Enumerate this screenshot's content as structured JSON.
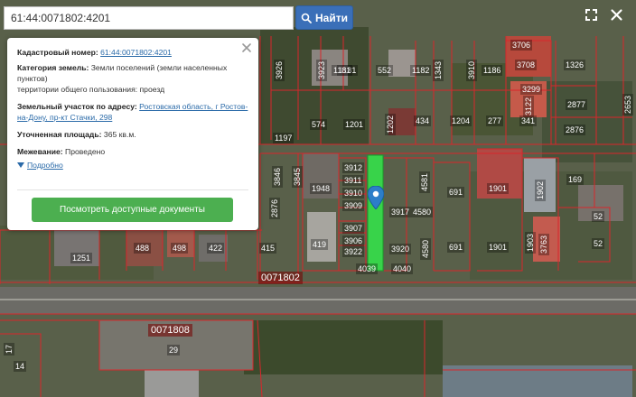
{
  "search": {
    "value": "61:44:0071802:4201",
    "button_label": "Найти"
  },
  "info_panel": {
    "cadastral_label": "Кадастровый номер:",
    "cadastral_value": "61:44:0071802:4201",
    "category_label": "Категория земель:",
    "category_value": "Земли поселений (земли населенных пунктов)",
    "usage_value": "территории общего пользования: проезд",
    "address_label": "Земельный участок по адресу:",
    "address_value": "Ростовская область, г Ростов-на-Дону, пр-кт Стачки, 298",
    "area_label": "Уточненная площадь:",
    "area_value": "365 кв.м.",
    "survey_label": "Межевание:",
    "survey_value": "Проведено",
    "details_label": "Подробно",
    "docs_button_label": "Посмотреть доступные документы"
  },
  "map": {
    "quarter_labels": [
      "0071802",
      "0071808"
    ],
    "plot_labels": [
      "3706",
      "3708",
      "1326",
      "3926",
      "3923",
      "1181",
      "552",
      "1182",
      "1181",
      "3910",
      "1186",
      "1343",
      "2877",
      "2876",
      "2653",
      "574",
      "1201",
      "1202",
      "434",
      "1204",
      "277",
      "341",
      "3122",
      "1197",
      "3299",
      "3912",
      "3911",
      "3910",
      "3909",
      "3907",
      "3906",
      "3922",
      "3917",
      "4580",
      "3920",
      "4580",
      "4581",
      "1948",
      "3846",
      "3845",
      "2876",
      "691",
      "1901",
      "1902",
      "169",
      "52",
      "52",
      "1901",
      "1903",
      "691",
      "3763",
      "488",
      "498",
      "422",
      "415",
      "419",
      "1251",
      "29",
      "14",
      "17",
      "4039",
      "4040"
    ],
    "colors": {
      "boundary": "#d9262b",
      "highlight": "#33e84a",
      "marker": "#2c7ec9"
    }
  },
  "icons": {
    "search": "search-icon",
    "expand": "expand-icon",
    "close_map": "close-icon",
    "close_panel": "close-icon",
    "marker": "map-marker-icon",
    "details": "caret-down-icon"
  }
}
